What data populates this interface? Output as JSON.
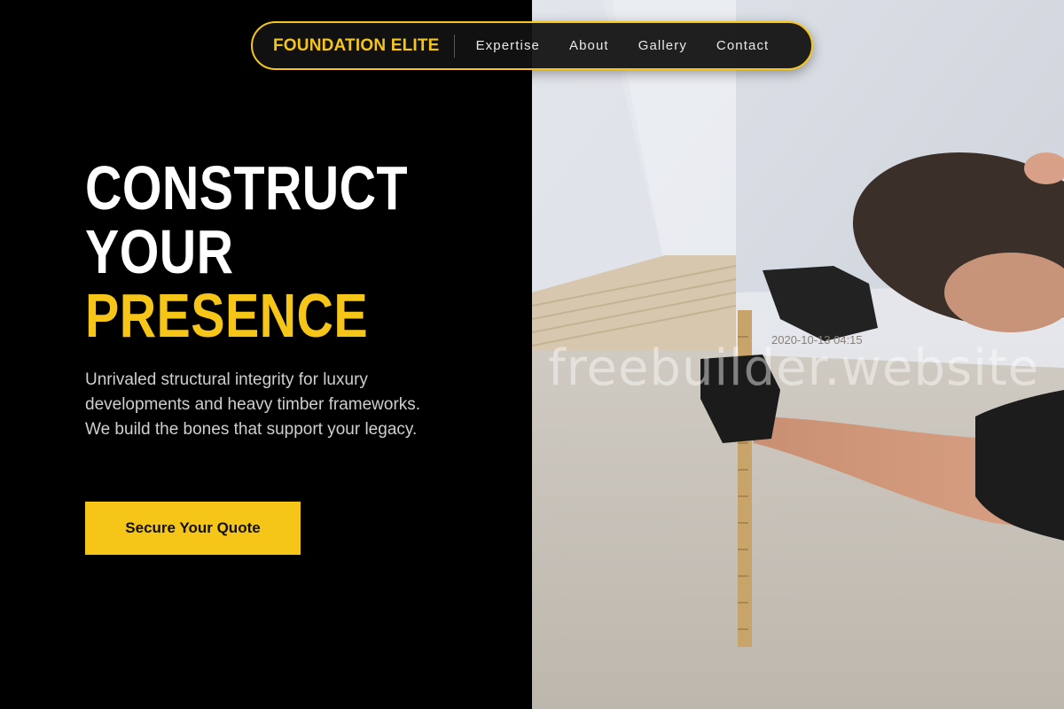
{
  "nav": {
    "brand": "FOUNDATION ELITE",
    "links": [
      "Expertise",
      "About",
      "Gallery",
      "Contact"
    ]
  },
  "hero": {
    "title_line1": "CONSTRUCT",
    "title_line2": "YOUR",
    "title_line3": "PRESENCE",
    "description": "Unrivaled structural integrity for luxury developments and heavy timber frameworks. We build the bones that support your legacy.",
    "cta_label": "Secure Your Quote"
  },
  "photo": {
    "stamp_text": "2020-10-13  04:15",
    "watermark": "freebuilder.website"
  },
  "colors": {
    "accent": "#f5c518",
    "background": "#000000",
    "text": "#ffffff"
  }
}
